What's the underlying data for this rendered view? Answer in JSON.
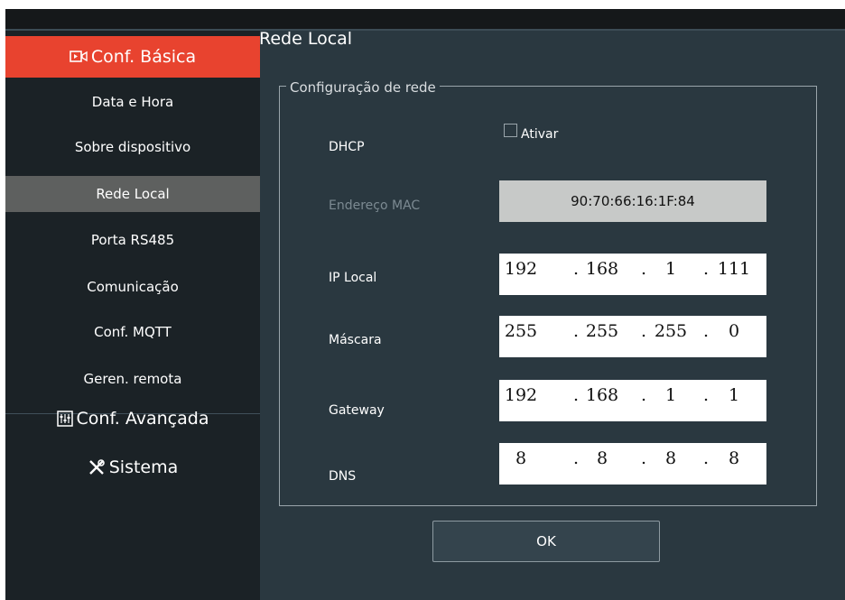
{
  "sidebar": {
    "basic_label": "Conf. Básica",
    "basic_icon": "video-icon",
    "items": [
      {
        "label": "Data e Hora"
      },
      {
        "label": "Sobre dispositivo"
      },
      {
        "label": "Rede Local",
        "selected": true
      },
      {
        "label": "Porta RS485"
      },
      {
        "label": "Comunicação"
      },
      {
        "label": "Conf. MQTT"
      },
      {
        "label": "Geren. remota"
      }
    ],
    "advanced_label": "Conf. Avançada",
    "advanced_icon": "sliders-icon",
    "system_label": "Sistema",
    "system_icon": "tools-icon"
  },
  "main": {
    "title": "Rede Local",
    "group_title": "Configuração de rede",
    "dhcp": {
      "label": "DHCP",
      "checkbox_label": "Ativar",
      "checked": false
    },
    "mac": {
      "label": "Endereço MAC",
      "value": "90:70:66:16:1F:84"
    },
    "ip": {
      "label": "IP Local",
      "octets": [
        "192",
        "168",
        "1",
        "111"
      ]
    },
    "mask": {
      "label": "Máscara",
      "octets": [
        "255",
        "255",
        "255",
        "0"
      ]
    },
    "gateway": {
      "label": "Gateway",
      "octets": [
        "192",
        "168",
        "1",
        "1"
      ]
    },
    "dns": {
      "label": "DNS",
      "octets": [
        "8",
        "8",
        "8",
        "8"
      ]
    },
    "ok_label": "OK",
    "dot": "."
  },
  "colors": {
    "accent": "#e8432f",
    "panel": "#2a3840",
    "sidebar": "#1b2226",
    "selected": "#5e605f"
  }
}
